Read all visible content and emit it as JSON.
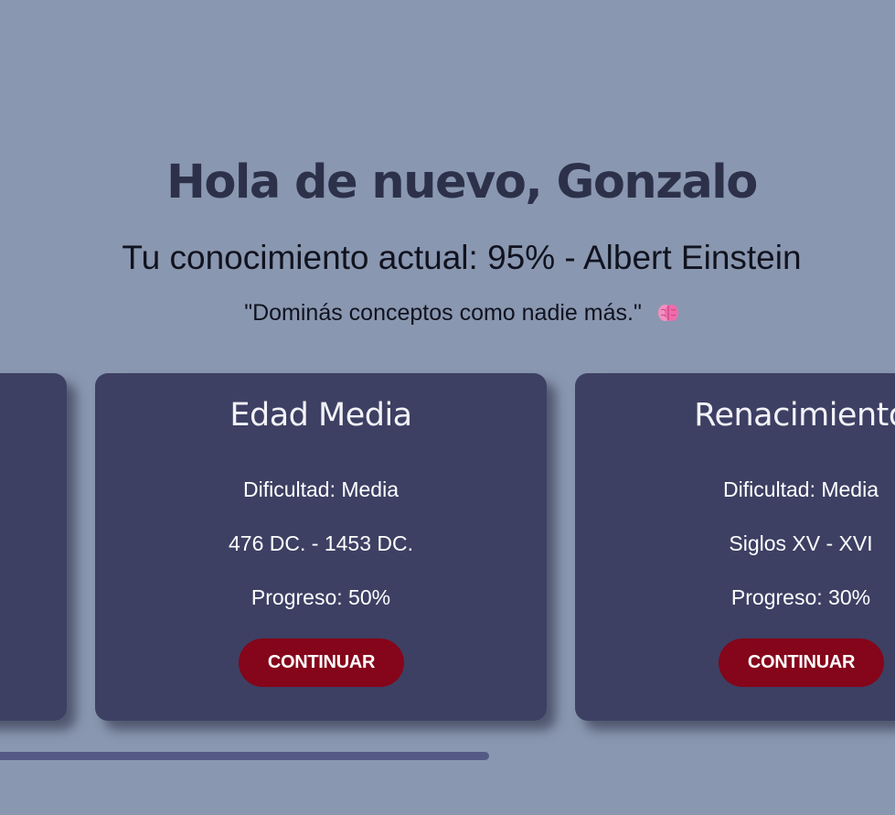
{
  "header": {
    "greeting": "Hola de nuevo, Gonzalo",
    "knowledge": "Tu conocimiento actual: 95% - Albert Einstein",
    "quote": "\"Dominás conceptos como nadie más.\"",
    "quote_icon": "brain-icon"
  },
  "cards": [
    {
      "title": "",
      "difficulty": "",
      "period": "",
      "progress": "",
      "button_label": ""
    },
    {
      "title": "Edad Media",
      "difficulty": "Dificultad: Media",
      "period": "476 DC. - 1453 DC.",
      "progress": "Progreso: 50%",
      "button_label": "CONTINUAR"
    },
    {
      "title": "Renacimiento",
      "difficulty": "Dificultad: Media",
      "period": "Siglos XV - XVI",
      "progress": "Progreso: 30%",
      "button_label": "CONTINUAR"
    }
  ],
  "colors": {
    "background": "#8a97b0",
    "card": "#3d4063",
    "button": "#85051a",
    "heading": "#2c3149",
    "scrollbar": "#545a85"
  }
}
